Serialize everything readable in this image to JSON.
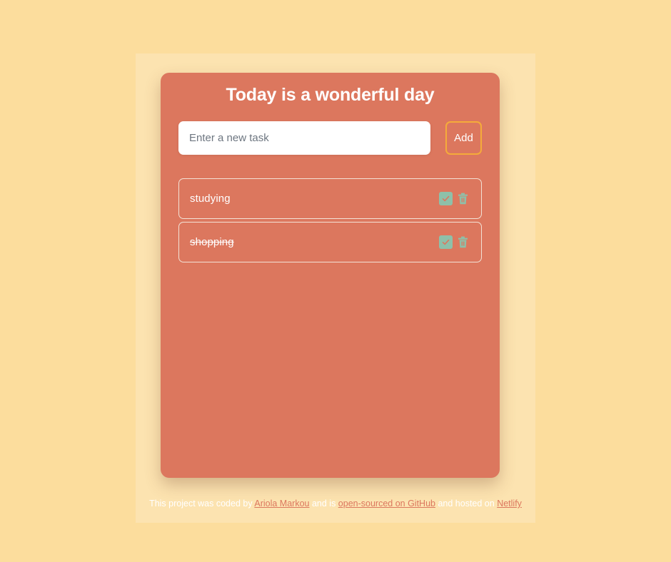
{
  "theme": {
    "page_background": "#fcdd9d",
    "card_background": "#dc775e",
    "accent_border": "#f5ab3a",
    "action_green": "#8ec0a9",
    "link_color": "#dc775e"
  },
  "app": {
    "title": "Today is a wonderful day"
  },
  "form": {
    "input_value": "",
    "input_placeholder": "Enter a new task",
    "add_label": "Add"
  },
  "tasks": [
    {
      "label": "studying",
      "completed": false,
      "complete_icon": "check-icon",
      "delete_icon": "trash-icon"
    },
    {
      "label": "shopping",
      "completed": true,
      "complete_icon": "check-icon",
      "delete_icon": "trash-icon"
    }
  ],
  "footer": {
    "part1": "This project was coded by ",
    "author_link": "Ariola Markou",
    "part2": " and is ",
    "source_link": "open-sourced on GitHub",
    "part3": " and hosted on ",
    "host_link": "Netlify"
  }
}
